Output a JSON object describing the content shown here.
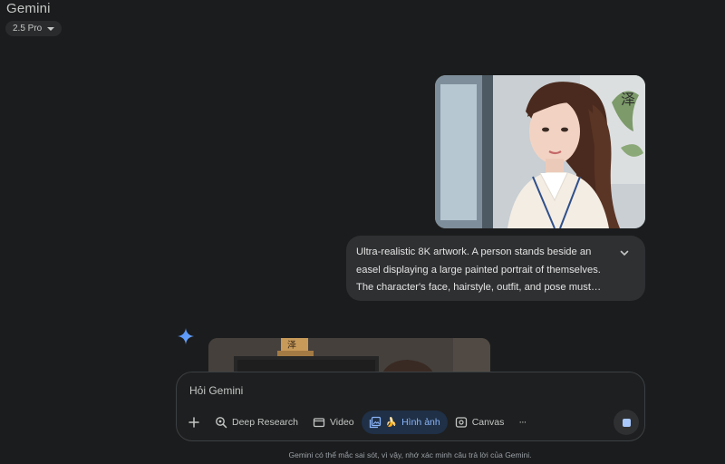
{
  "header": {
    "app_title": "Gemini",
    "model_label": "2.5 Pro"
  },
  "user_message": {
    "image_alt": "uploaded portrait photo",
    "text": "Ultra-realistic 8K artwork. A person stands beside an easel displaying a large painted portrait of themselves. The character's face, hairstyle, outfit, and pose must…"
  },
  "composer": {
    "placeholder": "Hỏi Gemini",
    "value": "",
    "tools": {
      "deep_research": "Deep Research",
      "video": "Video",
      "image_emoji": "🍌",
      "image": "Hình ảnh",
      "canvas": "Canvas",
      "more": "···"
    }
  },
  "disclaimer": "Gemini có thể mắc sai sót, vì vậy, nhớ xác minh câu trả lời của Gemini.",
  "colors": {
    "background": "#1b1c1d",
    "bubble": "#2f3032",
    "accent": "#8ab4f8",
    "active_chip": "#1f3047"
  },
  "icons": {
    "expand": "chevron-down-icon",
    "spark": "gemini-spark-icon",
    "add": "plus-icon",
    "deep_research": "deep-research-icon",
    "video": "video-icon",
    "image": "image-gallery-icon",
    "canvas": "canvas-icon",
    "stop": "stop-icon"
  }
}
